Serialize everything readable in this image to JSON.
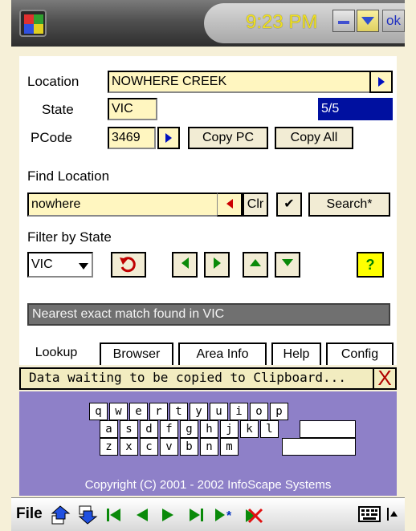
{
  "titlebar": {
    "time": "9:23 PM",
    "ok_label": "ok"
  },
  "location": {
    "label": "Location",
    "value": "NOWHERE CREEK",
    "state_label": "State",
    "state_value": "VIC",
    "match_count": "5/5",
    "pcode_label": "PCode",
    "pcode_value": "3469",
    "copy_pc_label": "Copy PC",
    "copy_all_label": "Copy All"
  },
  "find": {
    "label": "Find Location",
    "value": "nowhere",
    "clr_label": "Clr",
    "check_label": "✔",
    "search_label": "Search*"
  },
  "filter": {
    "label": "Filter by State",
    "selected": "VIC",
    "help_label": "?"
  },
  "status_message": "Nearest exact match found in VIC",
  "tabs": [
    {
      "label": "Lookup"
    },
    {
      "label": "Browser"
    },
    {
      "label": "Area Info"
    },
    {
      "label": "Help"
    },
    {
      "label": "Config"
    }
  ],
  "clipboard": {
    "message": "Data waiting to be copied to Clipboard...",
    "close_label": "X"
  },
  "keyboard": {
    "row1": [
      "q",
      "w",
      "e",
      "r",
      "t",
      "y",
      "u",
      "i",
      "o",
      "p"
    ],
    "row2": [
      "a",
      "s",
      "d",
      "f",
      "g",
      "h",
      "j",
      "k",
      "l"
    ],
    "row3": [
      "z",
      "x",
      "c",
      "v",
      "b",
      "n",
      "m"
    ]
  },
  "copyright": "Copyright (C) 2001 - 2002 InfoScape Systems",
  "bottombar": {
    "file_label": "File"
  },
  "colors": {
    "clock": "#f0e020",
    "field_bg": "#fff6c0",
    "keyboard_bg": "#8e80c8",
    "selection": "#0010a0",
    "nav_green": "#0a8a0a"
  }
}
